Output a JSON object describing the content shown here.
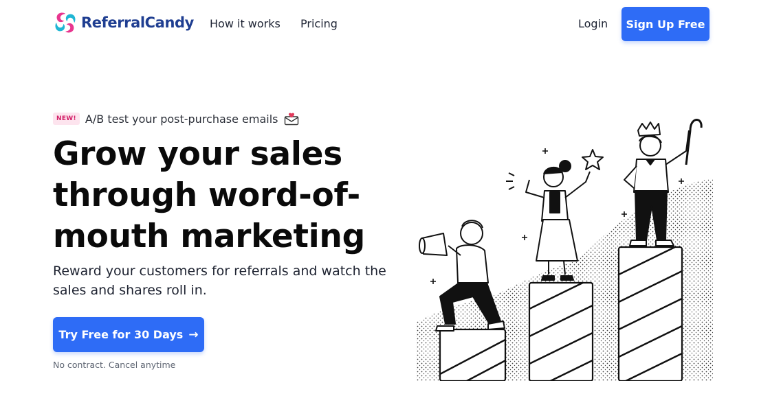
{
  "header": {
    "logo_text": "ReferralCandy",
    "nav": [
      {
        "label": "How it works"
      },
      {
        "label": "Pricing"
      }
    ],
    "login_label": "Login",
    "signup_label": "Sign Up Free"
  },
  "hero": {
    "badge": "NEW!",
    "announcement": "A/B test your post-purchase emails",
    "announcement_icon": "envelope-heart-icon",
    "title": "Grow your sales through word-of-mouth marketing",
    "subtitle": "Reward your customers for referrals and watch the sales and shares roll in.",
    "cta_label": "Try Free for 30 Days",
    "cta_icon": "arrow-right-icon",
    "cta_note": "No contract. Cancel anytime"
  },
  "colors": {
    "primary": "#2e6cf6",
    "logo_text": "#1f3e91",
    "badge_bg": "#fde4ee",
    "badge_text": "#d21f67",
    "logo_pink": "#e8368f",
    "logo_cyan": "#1fb6d4"
  }
}
